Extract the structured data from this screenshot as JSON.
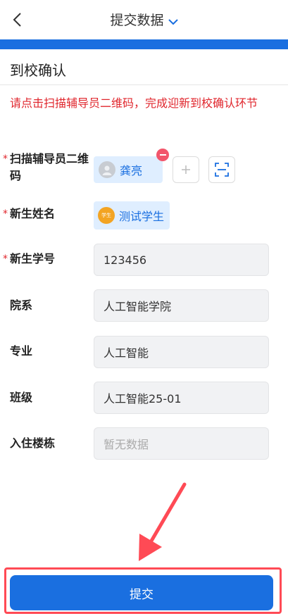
{
  "nav": {
    "title": "提交数据"
  },
  "section": {
    "title": "到校确认"
  },
  "notice": "请点击扫描辅导员二维码，完成迎新到校确认环节",
  "fields": {
    "counselor_qr": {
      "label": "扫描辅导员二维码",
      "chip_name": "龚亮"
    },
    "student_name": {
      "label": "新生姓名",
      "chip_avatar_text": "学生",
      "chip_name": "测试学生"
    },
    "student_id": {
      "label": "新生学号",
      "value": "123456"
    },
    "department": {
      "label": "院系",
      "value": "人工智能学院"
    },
    "major": {
      "label": "专业",
      "value": "人工智能"
    },
    "class": {
      "label": "班级",
      "value": "人工智能25-01"
    },
    "dorm": {
      "label": "入住楼栋",
      "placeholder": "暂无数据"
    }
  },
  "submit_label": "提交",
  "colors": {
    "accent": "#1a6fe0",
    "alert": "#e0262d",
    "annotation": "#ff4a55"
  }
}
